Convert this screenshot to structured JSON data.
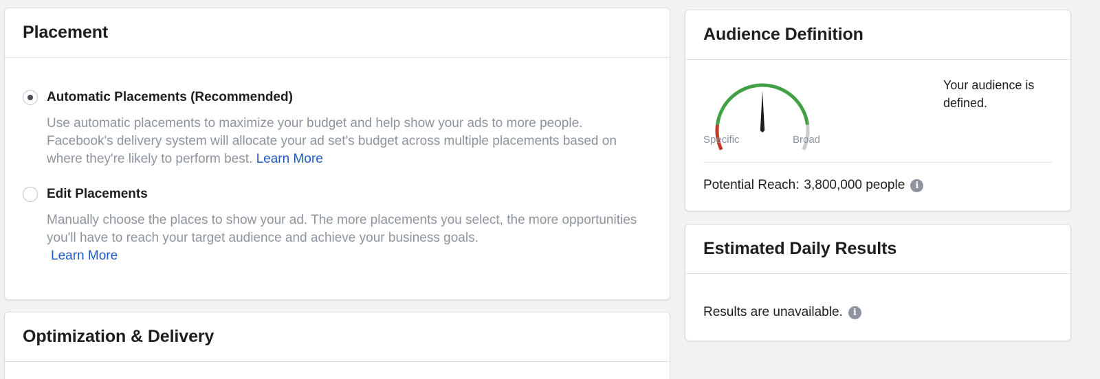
{
  "placement": {
    "title": "Placement",
    "automatic": {
      "label": "Automatic Placements (Recommended)",
      "selected": true,
      "description": "Use automatic placements to maximize your budget and help show your ads to more people. Facebook's delivery system will allocate your ad set's budget across multiple placements based on where they're likely to perform best.",
      "link": "Learn More"
    },
    "edit": {
      "label": "Edit Placements",
      "selected": false,
      "description": "Manually choose the places to show your ad. The more placements you select, the more opportunities you'll have to reach your target audience and achieve your business goals.",
      "link": "Learn More"
    }
  },
  "optimization": {
    "title": "Optimization & Delivery"
  },
  "audience": {
    "title": "Audience Definition",
    "gauge": {
      "min_label": "Specific",
      "max_label": "Broad",
      "level": 0.5,
      "icon": "gauge-icon",
      "colors": {
        "narrow": "#c0392b",
        "ideal": "#42a046",
        "broad": "#cccccc",
        "needle": "#1c1e21"
      }
    },
    "message": "Your audience is defined.",
    "reach_label": "Potential Reach:",
    "reach_value": "3,800,000 people",
    "info_icon": "info-icon"
  },
  "estimated": {
    "title": "Estimated Daily Results",
    "message": "Results are unavailable.",
    "info_icon": "info-icon"
  },
  "colors": {
    "link": "#1f5bc4",
    "muted_text": "#8d949e",
    "background": "#f2f2f2"
  }
}
